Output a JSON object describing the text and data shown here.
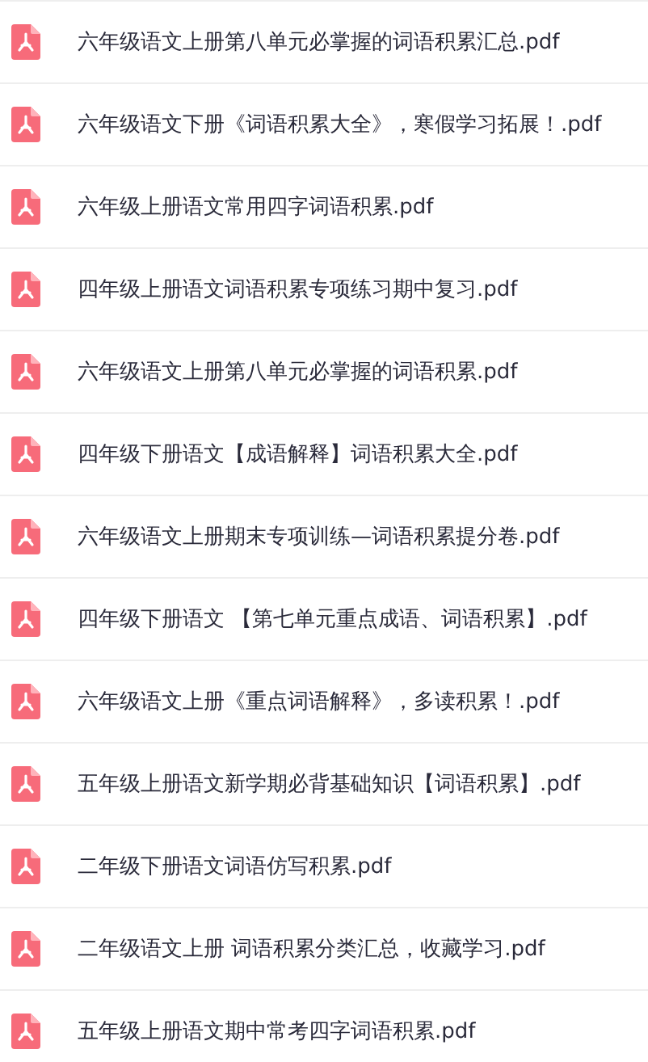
{
  "files": [
    {
      "name": "六年级语文上册第八单元必掌握的词语积累汇总.pdf"
    },
    {
      "name": "六年级语文下册《词语积累大全》，寒假学习拓展！.pdf"
    },
    {
      "name": "六年级上册语文常用四字词语积累.pdf"
    },
    {
      "name": "四年级上册语文词语积累专项练习期中复习.pdf"
    },
    {
      "name": "六年级语文上册第八单元必掌握的词语积累.pdf"
    },
    {
      "name": "四年级下册语文【成语解释】词语积累大全.pdf"
    },
    {
      "name": "六年级语文上册期末专项训练—词语积累提分卷.pdf"
    },
    {
      "name": "四年级下册语文 【第七单元重点成语、词语积累】.pdf"
    },
    {
      "name": "六年级语文上册《重点词语解释》，多读积累！.pdf"
    },
    {
      "name": "五年级上册语文新学期必背基础知识【词语积累】.pdf"
    },
    {
      "name": "二年级下册语文词语仿写积累.pdf"
    },
    {
      "name": "二年级语文上册 词语积累分类汇总，收藏学习.pdf"
    },
    {
      "name": "五年级上册语文期中常考四字词语积累.pdf"
    }
  ]
}
